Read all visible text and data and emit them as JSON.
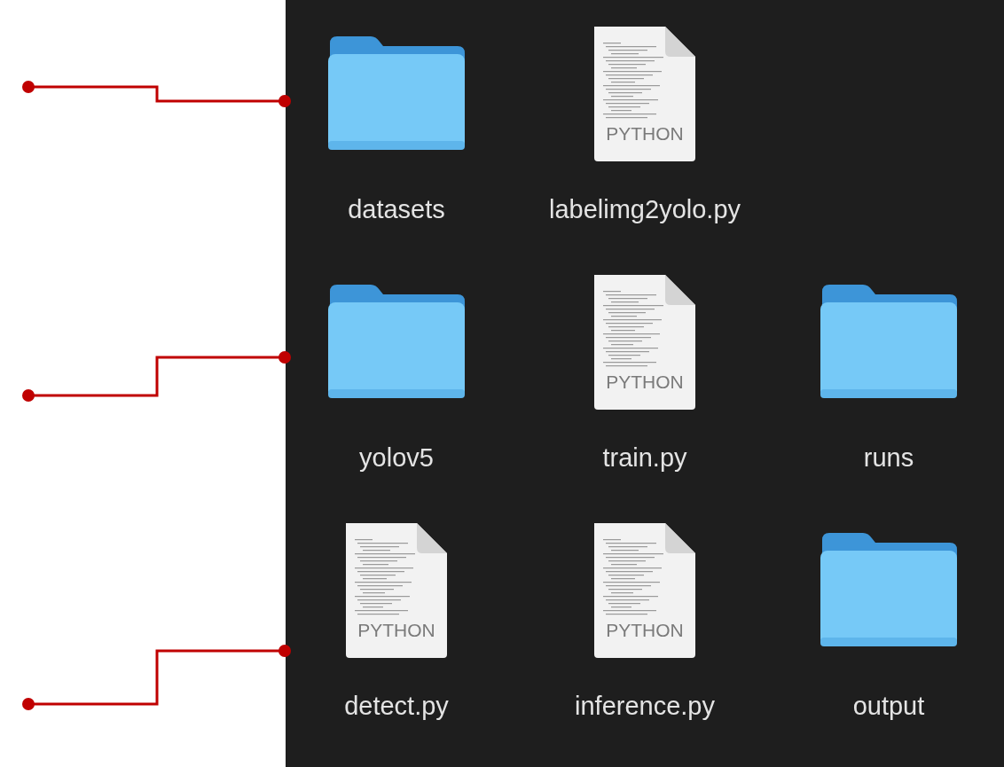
{
  "items": [
    {
      "kind": "folder",
      "name": "datasets"
    },
    {
      "kind": "file",
      "name": "labelimg2yolo.py",
      "badge": "PYTHON"
    },
    {
      "kind": "empty"
    },
    {
      "kind": "folder",
      "name": "yolov5"
    },
    {
      "kind": "file",
      "name": "train.py",
      "badge": "PYTHON"
    },
    {
      "kind": "folder",
      "name": "runs"
    },
    {
      "kind": "file",
      "name": "detect.py",
      "badge": "PYTHON"
    },
    {
      "kind": "file",
      "name": "inference.py",
      "badge": "PYTHON"
    },
    {
      "kind": "folder",
      "name": "output"
    }
  ]
}
